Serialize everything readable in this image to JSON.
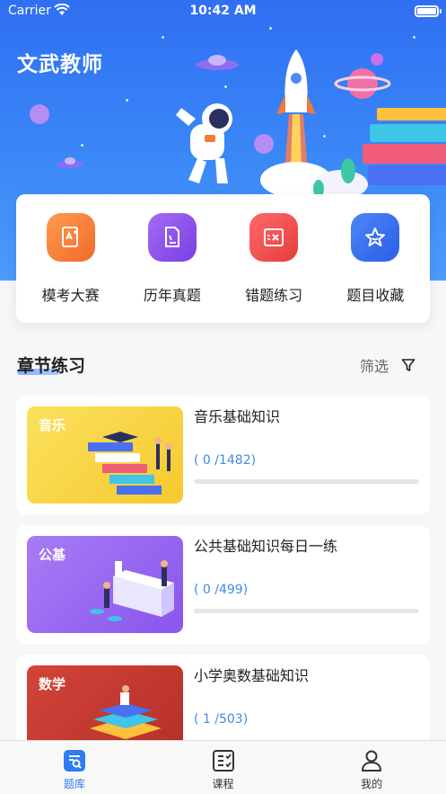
{
  "status_bar": {
    "carrier": "Carrier",
    "time": "10:42 AM"
  },
  "app": {
    "title": "文武教师"
  },
  "quick_actions": [
    {
      "label": "模考大赛",
      "icon": "exam-paper-icon",
      "color": "#f47a3a"
    },
    {
      "label": "历年真题",
      "icon": "document-icon",
      "color": "#8a4de8"
    },
    {
      "label": "错题练习",
      "icon": "wrong-answer-icon",
      "color": "#ef4848"
    },
    {
      "label": "题目收藏",
      "icon": "star-favorite-icon",
      "color": "#2f6ef0"
    }
  ],
  "section": {
    "title": "章节练习",
    "filter_label": "筛选"
  },
  "courses": [
    {
      "tag": "音乐",
      "title": "音乐基础知识",
      "progress_text": "( 0 /1482)",
      "progress": 0,
      "thumb_color": "#f7d645"
    },
    {
      "tag": "公基",
      "title": "公共基础知识每日一练",
      "progress_text": "( 0 /499)",
      "progress": 0,
      "thumb_color": "#9c6af2"
    },
    {
      "tag": "数学",
      "title": "小学奥数基础知识",
      "progress_text": "( 1 /503)",
      "progress": 0.002,
      "thumb_color": "#c9392f"
    }
  ],
  "tabs": [
    {
      "label": "题库",
      "icon": "question-bank-icon",
      "active": true
    },
    {
      "label": "课程",
      "icon": "course-list-icon",
      "active": false
    },
    {
      "label": "我的",
      "icon": "profile-icon",
      "active": false
    }
  ]
}
